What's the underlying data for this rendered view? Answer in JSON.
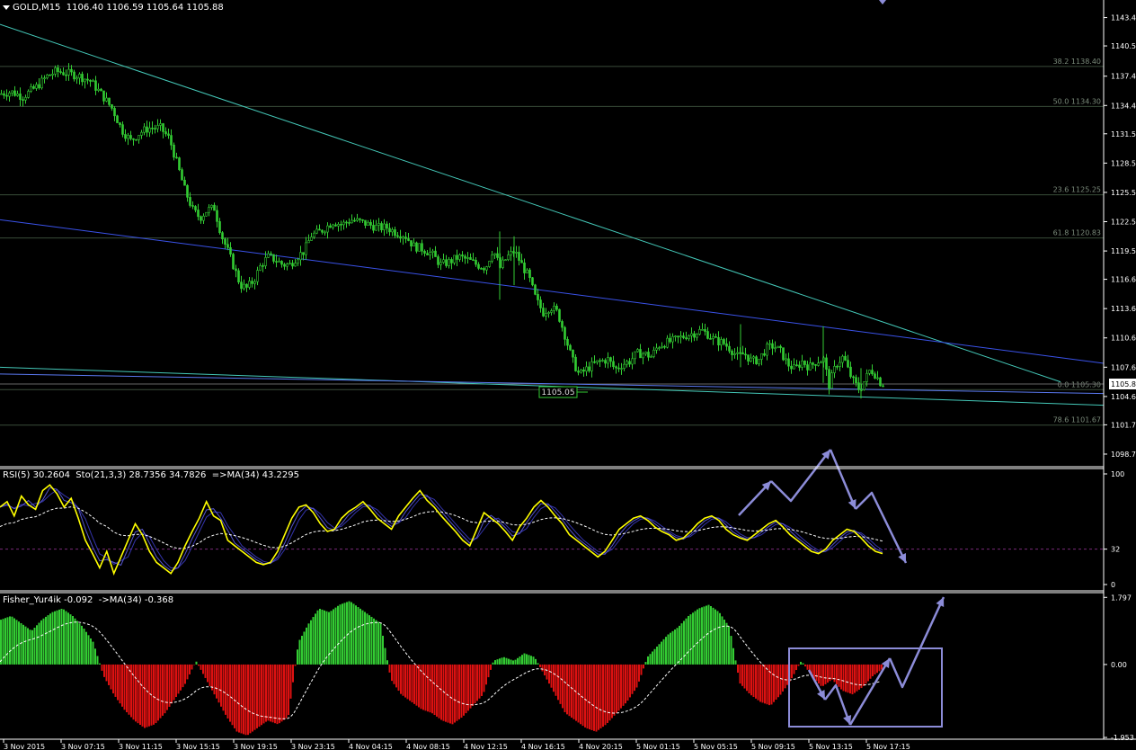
{
  "window": {
    "symbol_label": "GOLD,M15",
    "ohlc": "1106.40 1106.59 1105.64 1105.88",
    "price_badge": "1105.8",
    "level_label": "1105.05"
  },
  "indicators": {
    "rsi_header": "RSI(5) 30.2604  Sto(21,3,3) 28.7356 34.7826  =>MA(34) 43.2295",
    "fisher_header": "Fisher_Yur4ik -0.092  ->MA(34) -0.368"
  },
  "colors": {
    "background": "#000000",
    "candle": "#33cc33",
    "grid": "#3a4a3a",
    "fib": "#3a4d3a",
    "trend_upper": "#44c8b8",
    "trend_blue": "#3a52e8",
    "trend_low": "#5a78f0",
    "rsi": "#ffff00",
    "stoch": "#5555cc",
    "ma": "#ffffff",
    "hist_pos": "#33cc33",
    "hist_neg": "#dd1111",
    "annot": "#8c8cd8"
  },
  "chart_data": [
    {
      "type": "candlestick",
      "title": "GOLD,M15",
      "y_ticks": [
        "1143.4",
        "1140.5",
        "1137.4",
        "1134.4",
        "1131.5",
        "1128.5",
        "1125.5",
        "1122.5",
        "1119.5",
        "1116.6",
        "1113.6",
        "1110.6",
        "1107.6",
        "1104.6",
        "1101.7",
        "1098.7"
      ],
      "ylim": [
        1097.5,
        1145.2
      ],
      "x_ticks": [
        "3 Nov 2015",
        "3 Nov 07:15",
        "3 Nov 11:15",
        "3 Nov 15:15",
        "3 Nov 19:15",
        "3 Nov 23:15",
        "4 Nov 04:15",
        "4 Nov 08:15",
        "4 Nov 12:15",
        "4 Nov 16:15",
        "4 Nov 20:15",
        "5 Nov 01:15",
        "5 Nov 05:15",
        "5 Nov 09:15",
        "5 Nov 13:15",
        "5 Nov 17:15"
      ],
      "fib_levels": [
        {
          "label": "38.2  1138.40",
          "value": 1138.4
        },
        {
          "label": "50.0  1134.30",
          "value": 1134.3
        },
        {
          "label": "23.6  1125.25",
          "value": 1125.25
        },
        {
          "label": "61.8  1120.83",
          "value": 1120.83
        },
        {
          "label": "0.0  1105.30",
          "value": 1105.3
        },
        {
          "label": "78.6  1101.67",
          "value": 1101.67
        }
      ],
      "close_path": [
        [
          0,
          1135.6
        ],
        [
          12,
          1135.8
        ],
        [
          25,
          1135.3
        ],
        [
          40,
          1136.3
        ],
        [
          52,
          1137.4
        ],
        [
          62,
          1137.9
        ],
        [
          75,
          1137.7
        ],
        [
          88,
          1137.4
        ],
        [
          100,
          1136.9
        ],
        [
          112,
          1135.6
        ],
        [
          125,
          1134.0
        ],
        [
          135,
          1131.9
        ],
        [
          145,
          1130.8
        ],
        [
          155,
          1131.6
        ],
        [
          165,
          1132.1
        ],
        [
          178,
          1132.1
        ],
        [
          188,
          1131.0
        ],
        [
          196,
          1128.6
        ],
        [
          205,
          1125.8
        ],
        [
          214,
          1123.7
        ],
        [
          222,
          1122.9
        ],
        [
          230,
          1123.7
        ],
        [
          238,
          1123.9
        ],
        [
          246,
          1121.1
        ],
        [
          253,
          1119.5
        ],
        [
          260,
          1117.8
        ],
        [
          267,
          1116.0
        ],
        [
          274,
          1115.7
        ],
        [
          282,
          1116.5
        ],
        [
          290,
          1118.1
        ],
        [
          298,
          1118.9
        ],
        [
          306,
          1118.6
        ],
        [
          314,
          1118.1
        ],
        [
          322,
          1118.1
        ],
        [
          330,
          1118.9
        ],
        [
          338,
          1119.5
        ],
        [
          346,
          1121.1
        ],
        [
          354,
          1121.4
        ],
        [
          362,
          1121.9
        ],
        [
          370,
          1122.5
        ],
        [
          380,
          1122.2
        ],
        [
          390,
          1122.7
        ],
        [
          400,
          1122.5
        ],
        [
          410,
          1122.2
        ],
        [
          420,
          1121.9
        ],
        [
          430,
          1121.9
        ],
        [
          440,
          1121.4
        ],
        [
          450,
          1121.1
        ],
        [
          460,
          1120.0
        ],
        [
          470,
          1119.7
        ],
        [
          480,
          1119.2
        ],
        [
          490,
          1118.1
        ],
        [
          500,
          1118.4
        ],
        [
          510,
          1118.9
        ],
        [
          520,
          1118.6
        ],
        [
          530,
          1118.1
        ],
        [
          540,
          1117.8
        ],
        [
          548,
          1119.7
        ],
        [
          556,
          1117.8
        ],
        [
          564,
          1118.9
        ],
        [
          572,
          1119.5
        ],
        [
          580,
          1118.1
        ],
        [
          588,
          1116.8
        ],
        [
          596,
          1114.5
        ],
        [
          604,
          1113.2
        ],
        [
          612,
          1113.8
        ],
        [
          620,
          1113.2
        ],
        [
          628,
          1110.9
        ],
        [
          636,
          1108.4
        ],
        [
          644,
          1106.8
        ],
        [
          652,
          1107.4
        ],
        [
          660,
          1107.9
        ],
        [
          668,
          1108.2
        ],
        [
          676,
          1108.4
        ],
        [
          684,
          1107.4
        ],
        [
          692,
          1107.9
        ],
        [
          700,
          1108.2
        ],
        [
          708,
          1109.0
        ],
        [
          716,
          1109.0
        ],
        [
          724,
          1108.7
        ],
        [
          732,
          1109.8
        ],
        [
          740,
          1110.1
        ],
        [
          748,
          1110.3
        ],
        [
          756,
          1110.6
        ],
        [
          764,
          1110.9
        ],
        [
          772,
          1111.1
        ],
        [
          780,
          1111.4
        ],
        [
          788,
          1110.9
        ],
        [
          796,
          1110.3
        ],
        [
          804,
          1110.1
        ],
        [
          812,
          1109.5
        ],
        [
          820,
          1108.7
        ],
        [
          828,
          1109.0
        ],
        [
          836,
          1108.2
        ],
        [
          844,
          1108.4
        ],
        [
          852,
          1109.5
        ],
        [
          860,
          1109.8
        ],
        [
          868,
          1109.2
        ],
        [
          876,
          1107.9
        ],
        [
          884,
          1107.4
        ],
        [
          892,
          1108.2
        ],
        [
          900,
          1107.6
        ],
        [
          908,
          1108.2
        ],
        [
          916,
          1108.4
        ],
        [
          922,
          1105.8
        ],
        [
          930,
          1107.9
        ],
        [
          938,
          1108.7
        ],
        [
          944,
          1107.1
        ],
        [
          950,
          1106.0
        ],
        [
          956,
          1105.3
        ],
        [
          962,
          1106.3
        ],
        [
          968,
          1107.4
        ],
        [
          974,
          1106.8
        ],
        [
          980,
          1105.9
        ]
      ],
      "annotation": "1105.05"
    },
    {
      "type": "line",
      "title": "RSI(5) 30.2604  Sto(21,3,3) 28.7356 34.7826  =>MA(34) 43.2295",
      "y_ticks": [
        "100",
        "32",
        "0"
      ],
      "ylim": [
        0,
        100
      ],
      "series": [
        {
          "name": "RSI(5)",
          "values": [
            70,
            75,
            62,
            80,
            72,
            68,
            85,
            90,
            82,
            70,
            78,
            60,
            40,
            28,
            15,
            30,
            10,
            25,
            40,
            55,
            45,
            30,
            20,
            15,
            10,
            20,
            35,
            48,
            60,
            75,
            62,
            58,
            40,
            35,
            30,
            25,
            20,
            18,
            20,
            30,
            45,
            60,
            70,
            72,
            65,
            55,
            48,
            50,
            60,
            66,
            70,
            75,
            68,
            60,
            55,
            50,
            62,
            70,
            78,
            85,
            76,
            70,
            62,
            55,
            48,
            40,
            35,
            50,
            65,
            60,
            55,
            48,
            40,
            52,
            60,
            70,
            76,
            70,
            62,
            55,
            45,
            40,
            35,
            30,
            25,
            30,
            40,
            50,
            55,
            60,
            62,
            58,
            52,
            48,
            45,
            40,
            42,
            48,
            55,
            60,
            62,
            58,
            50,
            45,
            42,
            40,
            45,
            50,
            55,
            58,
            52,
            45,
            40,
            35,
            30,
            28,
            32,
            40,
            45,
            50,
            48,
            42,
            35,
            30,
            28
          ]
        }
      ]
    },
    {
      "type": "bar",
      "title": "Fisher_Yur4ik -0.092  ->MA(34) -0.368",
      "y_ticks": [
        "1.797",
        "0.00",
        "-1.953"
      ],
      "ylim": [
        -2.0,
        1.9
      ],
      "series": [
        {
          "name": "Fisher",
          "values": [
            1.2,
            1.3,
            1.1,
            0.9,
            1.2,
            1.4,
            1.5,
            1.3,
            1.0,
            0.6,
            -0.3,
            -0.8,
            -1.2,
            -1.5,
            -1.7,
            -1.6,
            -1.3,
            -0.9,
            -0.5,
            0.1,
            -0.4,
            -0.9,
            -1.4,
            -1.8,
            -1.9,
            -1.7,
            -1.5,
            -1.6,
            -1.4,
            0.6,
            1.1,
            1.5,
            1.4,
            1.6,
            1.7,
            1.5,
            1.3,
            1.1,
            -0.4,
            -0.8,
            -1.0,
            -1.2,
            -1.3,
            -1.5,
            -1.6,
            -1.4,
            -1.1,
            -0.8,
            0.1,
            0.2,
            0.1,
            0.3,
            0.2,
            -0.3,
            -0.8,
            -1.3,
            -1.5,
            -1.7,
            -1.8,
            -1.6,
            -1.3,
            -1.0,
            -0.6,
            0.2,
            0.5,
            0.8,
            1.0,
            1.3,
            1.5,
            1.6,
            1.4,
            1.0,
            -0.5,
            -0.8,
            -1.0,
            -1.1,
            -0.8,
            -0.4,
            0.1,
            -0.3,
            -0.6,
            -0.4,
            -0.7,
            -0.8,
            -0.6,
            -0.3,
            -0.1
          ]
        }
      ]
    }
  ]
}
